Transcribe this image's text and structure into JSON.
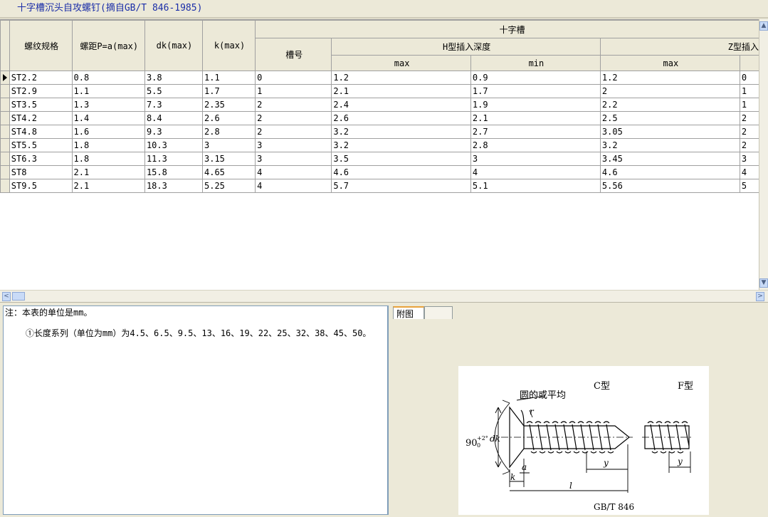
{
  "window": {
    "title": "十字槽沉头自攻螺钉(摘自GB/T 846-1985)"
  },
  "table": {
    "group_header": "十字槽",
    "columns": [
      "螺纹规格",
      "螺距P=a(max)",
      "dk(max)",
      "k(max)"
    ],
    "slot_no": "槽号",
    "h_depth": "H型插入深度",
    "z_depth": "Z型插入深",
    "sub": {
      "h_max": "max",
      "h_min": "min",
      "z_max": "max"
    },
    "rows": [
      [
        "ST2.2",
        "0.8",
        "3.8",
        "1.1",
        "0",
        "1.2",
        "0.9",
        "1.2",
        "0"
      ],
      [
        "ST2.9",
        "1.1",
        "5.5",
        "1.7",
        "1",
        "2.1",
        "1.7",
        "2",
        "1"
      ],
      [
        "ST3.5",
        "1.3",
        "7.3",
        "2.35",
        "2",
        "2.4",
        "1.9",
        "2.2",
        "1"
      ],
      [
        "ST4.2",
        "1.4",
        "8.4",
        "2.6",
        "2",
        "2.6",
        "2.1",
        "2.5",
        "2"
      ],
      [
        "ST4.8",
        "1.6",
        "9.3",
        "2.8",
        "2",
        "3.2",
        "2.7",
        "3.05",
        "2"
      ],
      [
        "ST5.5",
        "1.8",
        "10.3",
        "3",
        "3",
        "3.2",
        "2.8",
        "3.2",
        "2"
      ],
      [
        "ST6.3",
        "1.8",
        "11.3",
        "3.15",
        "3",
        "3.5",
        "3",
        "3.45",
        "3"
      ],
      [
        "ST8",
        "2.1",
        "15.8",
        "4.65",
        "4",
        "4.6",
        "4",
        "4.6",
        "4"
      ],
      [
        "ST9.5",
        "2.1",
        "18.3",
        "5.25",
        "4",
        "5.7",
        "5.1",
        "5.56",
        "5"
      ]
    ]
  },
  "scrollbars": {
    "up": "▲",
    "down": "▼",
    "left": "<",
    "right": ">"
  },
  "note": {
    "line1": "注：本表的单位是mm。",
    "line2": "    ①长度系列（单位为mm）为4.5、6.5、9.5、13、16、19、22、25、32、38、45、50。"
  },
  "tabs": {
    "figure_tab": "附图",
    "blank_tab": ""
  },
  "figure": {
    "type_c": "C型",
    "type_f": "F型",
    "round_or_flat": "圆的或平均",
    "angle": "90",
    "tol_plus": "+2°",
    "tol_zero": "0",
    "label_dk": "dk",
    "label_r": "r",
    "label_a": "a",
    "label_k": "k",
    "label_l": "l",
    "label_y": "y",
    "label_y2": "y",
    "standard": "GB/T 846"
  }
}
